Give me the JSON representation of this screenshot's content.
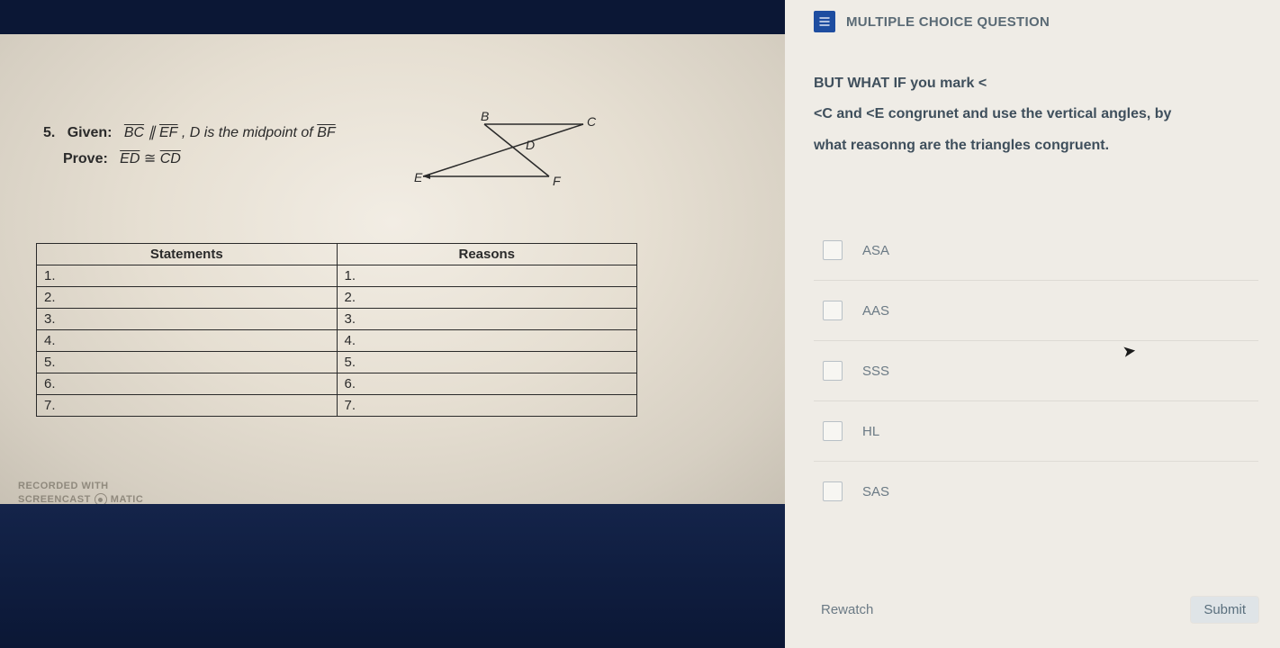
{
  "header": {
    "title": "MULTIPLE CHOICE QUESTION"
  },
  "question": {
    "line1": "BUT WHAT IF you mark <",
    "line2": "<C and <E congrunet and use the vertical angles, by",
    "line3": "what reasonng are the triangles congruent."
  },
  "options": [
    {
      "label": "ASA"
    },
    {
      "label": "AAS"
    },
    {
      "label": "SSS"
    },
    {
      "label": "HL"
    },
    {
      "label": "SAS"
    }
  ],
  "actions": {
    "rewatch": "Rewatch",
    "submit": "Submit"
  },
  "slide": {
    "problem_number": "5.",
    "given_label": "Given:",
    "given_text_a": "BC",
    "given_parallel": "∥",
    "given_text_b": "EF",
    "given_rest": ", D is the midpoint of ",
    "given_text_c": "BF",
    "prove_label": "Prove:",
    "prove_text_a": "ED",
    "prove_cong": "≅",
    "prove_text_b": "CD",
    "headers": {
      "statements": "Statements",
      "reasons": "Reasons"
    },
    "rows": [
      "1.",
      "2.",
      "3.",
      "4.",
      "5.",
      "6.",
      "7."
    ],
    "figure_labels": {
      "B": "B",
      "C": "C",
      "D": "D",
      "E": "E",
      "F": "F"
    },
    "watermark_line1": "recorded with",
    "watermark_line2a": "SCREENCAST",
    "watermark_line2b": "MATIC"
  }
}
